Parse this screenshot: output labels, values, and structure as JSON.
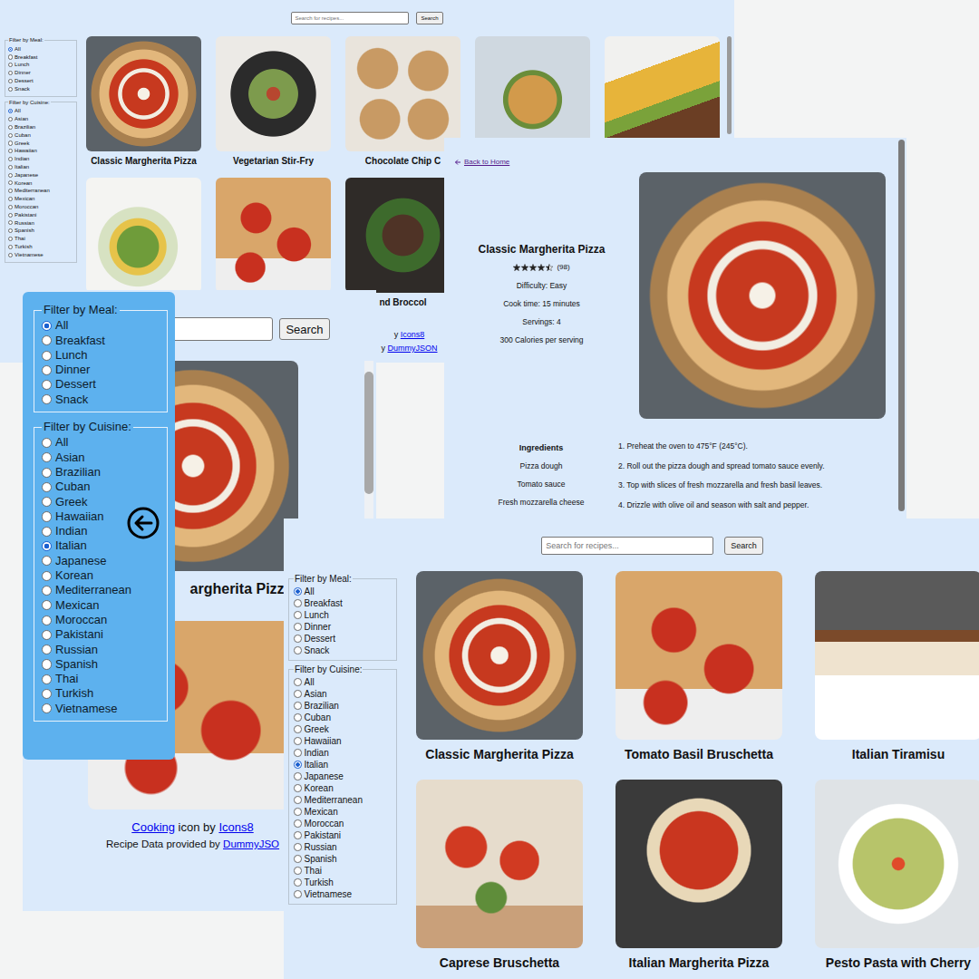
{
  "desktop_home": {
    "search": {
      "placeholder": "Search for recipes...",
      "button": "Search"
    },
    "filters": [
      {
        "legend": "Filter by Meal:",
        "options": [
          {
            "label": "All",
            "selected": true
          },
          {
            "label": "Breakfast",
            "selected": false
          },
          {
            "label": "Lunch",
            "selected": false
          },
          {
            "label": "Dinner",
            "selected": false
          },
          {
            "label": "Dessert",
            "selected": false
          },
          {
            "label": "Snack",
            "selected": false
          }
        ]
      },
      {
        "legend": "Filter by Cuisine:",
        "options": [
          {
            "label": "All",
            "selected": true
          },
          {
            "label": "Asian",
            "selected": false
          },
          {
            "label": "Brazilian",
            "selected": false
          },
          {
            "label": "Cuban",
            "selected": false
          },
          {
            "label": "Greek",
            "selected": false
          },
          {
            "label": "Hawaiian",
            "selected": false
          },
          {
            "label": "Indian",
            "selected": false
          },
          {
            "label": "Italian",
            "selected": false
          },
          {
            "label": "Japanese",
            "selected": false
          },
          {
            "label": "Korean",
            "selected": false
          },
          {
            "label": "Mediterranean",
            "selected": false
          },
          {
            "label": "Mexican",
            "selected": false
          },
          {
            "label": "Moroccan",
            "selected": false
          },
          {
            "label": "Pakistani",
            "selected": false
          },
          {
            "label": "Russian",
            "selected": false
          },
          {
            "label": "Spanish",
            "selected": false
          },
          {
            "label": "Thai",
            "selected": false
          },
          {
            "label": "Turkish",
            "selected": false
          },
          {
            "label": "Vietnamese",
            "selected": false
          }
        ]
      }
    ],
    "cards": [
      {
        "title": "Classic Margherita Pizza"
      },
      {
        "title": "Vegetarian Stir-Fry"
      },
      {
        "title": "Chocolate Chip C"
      },
      {},
      {},
      {},
      {},
      {
        "title": "nd Broccol"
      }
    ],
    "footer": [
      {
        "prefix": "y ",
        "link": "Icons8"
      },
      {
        "prefix": "y ",
        "link": "DummyJSON"
      }
    ]
  },
  "mobile_home": {
    "search": {
      "button": "Search"
    },
    "recipe_title": "argherita Pizza",
    "credits": [
      {
        "parts": [
          {
            "text": "Cooking",
            "kind": "link"
          },
          {
            "text": " icon by ",
            "kind": "text"
          },
          {
            "text": "Icons8",
            "kind": "link"
          }
        ]
      },
      {
        "parts": [
          {
            "text": "Recipe Data provided by ",
            "kind": "text"
          },
          {
            "text": "DummyJSO",
            "kind": "link"
          }
        ]
      }
    ],
    "drawer": {
      "filters": [
        {
          "legend": "Filter by Meal:",
          "options": [
            {
              "label": "All",
              "selected": true
            },
            {
              "label": "Breakfast",
              "selected": false
            },
            {
              "label": "Lunch",
              "selected": false
            },
            {
              "label": "Dinner",
              "selected": false
            },
            {
              "label": "Dessert",
              "selected": false
            },
            {
              "label": "Snack",
              "selected": false
            }
          ]
        },
        {
          "legend": "Filter by Cuisine:",
          "options": [
            {
              "label": "All",
              "selected": false
            },
            {
              "label": "Asian",
              "selected": false
            },
            {
              "label": "Brazilian",
              "selected": false
            },
            {
              "label": "Cuban",
              "selected": false
            },
            {
              "label": "Greek",
              "selected": false
            },
            {
              "label": "Hawaiian",
              "selected": false
            },
            {
              "label": "Indian",
              "selected": false
            },
            {
              "label": "Italian",
              "selected": true
            },
            {
              "label": "Japanese",
              "selected": false
            },
            {
              "label": "Korean",
              "selected": false
            },
            {
              "label": "Mediterranean",
              "selected": false
            },
            {
              "label": "Mexican",
              "selected": false
            },
            {
              "label": "Moroccan",
              "selected": false
            },
            {
              "label": "Pakistani",
              "selected": false
            },
            {
              "label": "Russian",
              "selected": false
            },
            {
              "label": "Spanish",
              "selected": false
            },
            {
              "label": "Thai",
              "selected": false
            },
            {
              "label": "Turkish",
              "selected": false
            },
            {
              "label": "Vietnamese",
              "selected": false
            }
          ]
        }
      ]
    }
  },
  "recipe_detail": {
    "back_link": "Back to Home",
    "title": "Classic Margherita Pizza",
    "rating": {
      "stars": 4.5,
      "count": "(98)"
    },
    "facts": [
      "Difficulty: Easy",
      "Cook time: 15 minutes",
      "Servings: 4",
      "300 Calories per serving"
    ],
    "ingredients": {
      "heading": "Ingredients",
      "items": [
        "Pizza dough",
        "Tomato sauce",
        "Fresh mozzarella cheese"
      ]
    },
    "instructions": [
      "1. Preheat the oven to 475°F (245°C).",
      "2. Roll out the pizza dough and spread tomato sauce evenly.",
      "3. Top with slices of fresh mozzarella and fresh basil leaves.",
      "4. Drizzle with olive oil and season with salt and pepper."
    ]
  },
  "filtered_home": {
    "search": {
      "placeholder": "Search for recipes...",
      "button": "Search"
    },
    "filters": [
      {
        "legend": "Filter by Meal:",
        "options": [
          {
            "label": "All",
            "selected": true
          },
          {
            "label": "Breakfast",
            "selected": false
          },
          {
            "label": "Lunch",
            "selected": false
          },
          {
            "label": "Dinner",
            "selected": false
          },
          {
            "label": "Dessert",
            "selected": false
          },
          {
            "label": "Snack",
            "selected": false
          }
        ]
      },
      {
        "legend": "Filter by Cuisine:",
        "options": [
          {
            "label": "All",
            "selected": false
          },
          {
            "label": "Asian",
            "selected": false
          },
          {
            "label": "Brazilian",
            "selected": false
          },
          {
            "label": "Cuban",
            "selected": false
          },
          {
            "label": "Greek",
            "selected": false
          },
          {
            "label": "Hawaiian",
            "selected": false
          },
          {
            "label": "Indian",
            "selected": false
          },
          {
            "label": "Italian",
            "selected": true
          },
          {
            "label": "Japanese",
            "selected": false
          },
          {
            "label": "Korean",
            "selected": false
          },
          {
            "label": "Mediterranean",
            "selected": false
          },
          {
            "label": "Mexican",
            "selected": false
          },
          {
            "label": "Moroccan",
            "selected": false
          },
          {
            "label": "Pakistani",
            "selected": false
          },
          {
            "label": "Russian",
            "selected": false
          },
          {
            "label": "Spanish",
            "selected": false
          },
          {
            "label": "Thai",
            "selected": false
          },
          {
            "label": "Turkish",
            "selected": false
          },
          {
            "label": "Vietnamese",
            "selected": false
          }
        ]
      }
    ],
    "cards": [
      {
        "title": "Classic Margherita Pizza"
      },
      {
        "title": "Tomato Basil Bruschetta"
      },
      {
        "title": "Italian Tiramisu"
      },
      {
        "title": "Caprese Bruschetta"
      },
      {
        "title": "Italian Margherita Pizza"
      },
      {
        "title": "Pesto Pasta with Cherry"
      }
    ]
  }
}
